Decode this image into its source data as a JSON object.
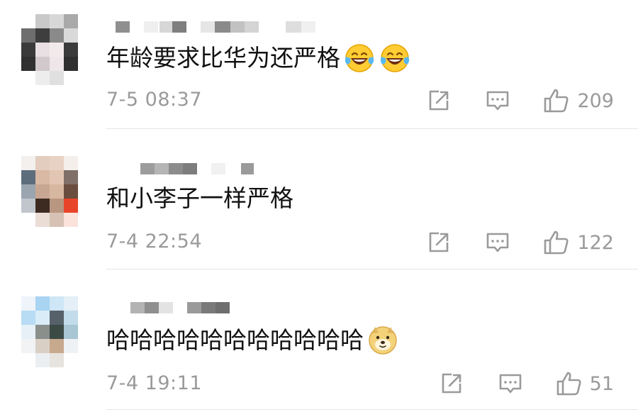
{
  "comments": [
    {
      "text": "年龄要求比华为还严格",
      "emojis": [
        "laugh-cry-emoji",
        "laugh-cry-emoji"
      ],
      "time": "7-5 08:37",
      "likes": "209"
    },
    {
      "text": "和小李子一样严格",
      "emojis": [],
      "time": "7-4 22:54",
      "likes": "122"
    },
    {
      "text": "哈哈哈哈哈哈哈哈哈哈哈",
      "emojis": [
        "doge-emoji"
      ],
      "time": "7-4 19:11",
      "likes": "51"
    }
  ],
  "icons": {
    "share": "share-icon",
    "reply": "comment-icon",
    "like": "thumbs-up-icon"
  },
  "colors": {
    "text": "#111111",
    "meta": "#9a9a9a",
    "icon": "#9a9a9a",
    "divider": "#e6e6e6"
  }
}
